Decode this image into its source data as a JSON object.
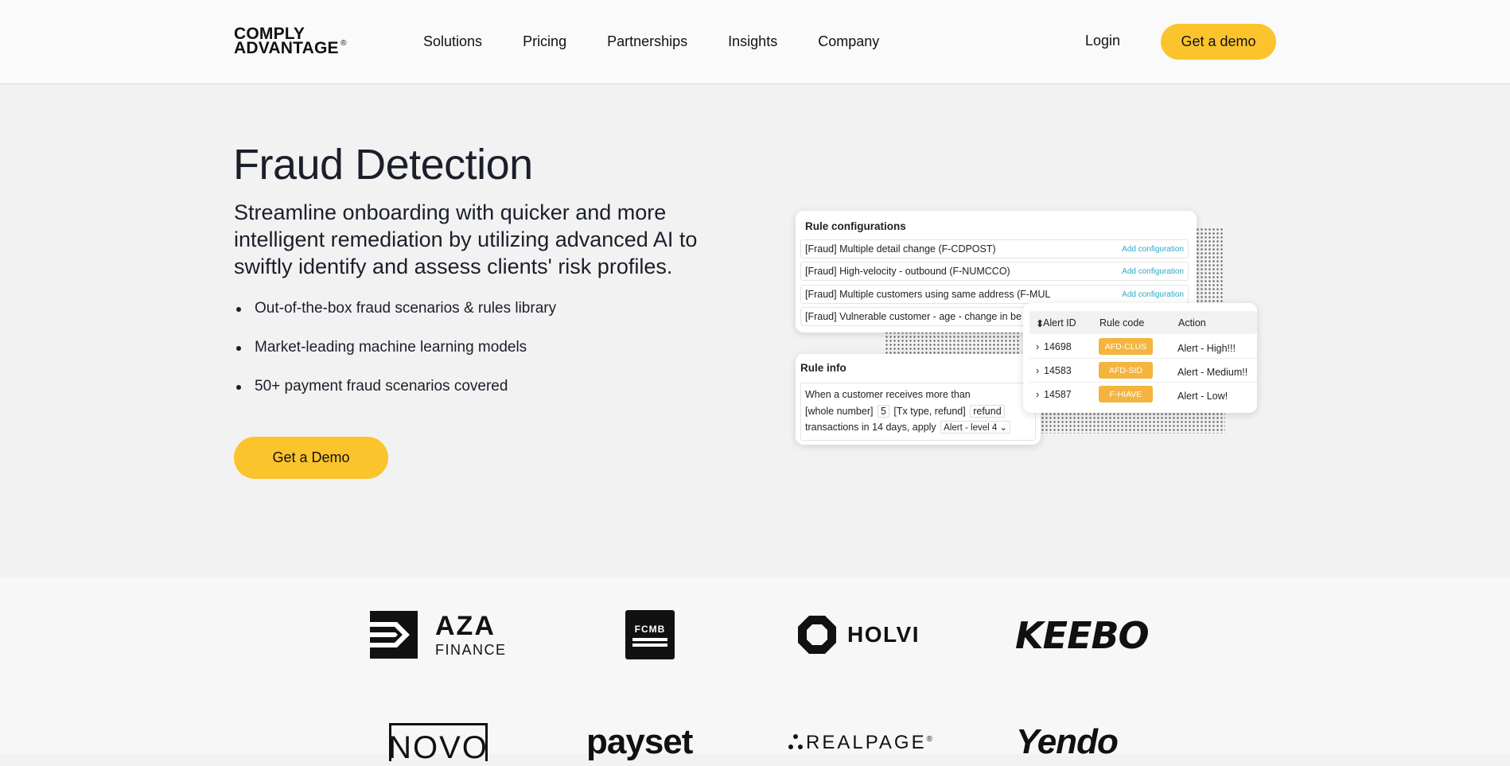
{
  "nav": {
    "logo_line1": "COMPLY",
    "logo_line2": "ADVANTAGE",
    "logo_mark": "®",
    "links": [
      "Solutions",
      "Pricing",
      "Partnerships",
      "Insights",
      "Company"
    ],
    "login": "Login",
    "demo": "Get a demo"
  },
  "hero": {
    "title": "Fraud Detection",
    "subtitle": "Streamline onboarding with quicker and more intelligent remediation by utilizing advanced AI to swiftly identify and assess clients' risk profiles.",
    "bullets": [
      "Out-of-the-box fraud scenarios & rules library",
      "Market-leading machine learning models",
      "50+ payment fraud scenarios covered"
    ],
    "cta": "Get a Demo"
  },
  "illustration": {
    "rules": {
      "title": "Rule configurations",
      "rows": [
        {
          "label": "[Fraud] Multiple detail change (F-CDPOST)",
          "action": "Add configuration"
        },
        {
          "label": "[Fraud] High-velocity - outbound (F-NUMCCO)",
          "action": "Add configuration"
        },
        {
          "label": "[Fraud] Multiple customers using same address (F-MUL",
          "action": "Add configuration"
        },
        {
          "label": "[Fraud] Vulnerable customer - age - change in be",
          "action": ""
        }
      ]
    },
    "info": {
      "title": "Rule info",
      "line1": "When a customer receives more than",
      "chip_number_label": "[whole number]",
      "chip_number_value": "5",
      "chip_type_label": "[Tx type, refund]",
      "chip_type_value": "refund",
      "line3": "transactions in 14 days, apply",
      "select_value": "Alert - level 4"
    },
    "alerts": {
      "headers": [
        "Alert ID",
        "Rule code",
        "Action"
      ],
      "rows": [
        {
          "id": "14698",
          "code": "AFD-CLUS",
          "action": "Alert - High!!!"
        },
        {
          "id": "14583",
          "code": "AFD-SID",
          "action": "Alert - Medium!!"
        },
        {
          "id": "14587",
          "code": "F-HIAVE",
          "action": "Alert - Low!"
        }
      ]
    }
  },
  "logos": {
    "aza_top": "AZA",
    "aza_bottom": "FINANCE",
    "fcmb": "FCMB",
    "holvi": "HOLVI",
    "keebo": "KEEBO",
    "novo": "NOVO",
    "payset": "payset",
    "realpage": "REALPAGE",
    "realpage_mark": "®",
    "yendo": "Yendo"
  },
  "colors": {
    "accent": "#fcc42c",
    "tag": "#f4b43e",
    "link": "#2fa8c2"
  }
}
